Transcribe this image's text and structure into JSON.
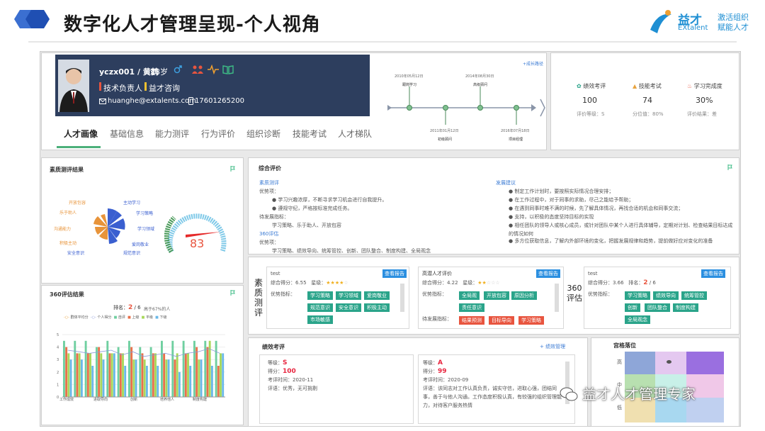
{
  "header": {
    "title": "数字化人才管理呈现-个人视角",
    "logo_brand": "益才",
    "logo_sub": "EXtalent",
    "logo_slogan_1": "激活组织",
    "logo_slogan_2": "赋能人才"
  },
  "profile": {
    "name": "yczx001 / 黄鹤",
    "age": "28岁",
    "role": "技术负责人",
    "company": "益才咨询",
    "email": "huanghe@extalents.com",
    "phone": "17601265200",
    "gender_icon": "male-icon"
  },
  "tabs": [
    "人才画像",
    "基础信息",
    "能力测评",
    "行为评价",
    "组织诊断",
    "技能考试",
    "人才梯队"
  ],
  "timeline": {
    "link": "+成长路径",
    "events": [
      {
        "date": "2010年05月12日",
        "title": "跟岗学习",
        "pos": "top"
      },
      {
        "date": "2011年01月12日",
        "title": "初级顾问",
        "pos": "bottom"
      },
      {
        "date": "2014年08月30日",
        "title": "高级顾问",
        "pos": "top"
      },
      {
        "date": "2016年07月18日",
        "title": "项目经理",
        "pos": "bottom"
      }
    ]
  },
  "stats": [
    {
      "label": "绩效考评",
      "value": "100",
      "sub": "评价等级：S",
      "color": "#2aa48a"
    },
    {
      "label": "技能考试",
      "value": "74",
      "sub": "分位值：80%",
      "color": "#e8a33f"
    },
    {
      "label": "学习完成度",
      "value": "30%",
      "sub": "评价结果：差",
      "color": "#e8553f"
    }
  ],
  "competency": {
    "title": "素质测评结果",
    "labels": [
      "主动学习",
      "学习策略",
      "学习领域",
      "爱岗敬业",
      "规范意识",
      "安全意识",
      "积极主动",
      "沟通能力",
      "乐于助人",
      "开放包容"
    ],
    "score": "83"
  },
  "eval360": {
    "title": "360评估结果",
    "rank_label": "排名：",
    "rank": "2",
    "rank_total": "/ 6",
    "rank_note": "高于67%的人",
    "legend": [
      "群体平均分",
      "个人得分",
      "自评",
      "上级",
      "平级",
      "下级"
    ],
    "categories": [
      "工作成效",
      "进取导向",
      "创新",
      "培养他人",
      "制度构建"
    ]
  },
  "chart_data": {
    "type": "bar",
    "title": "360评估结果",
    "categories": [
      "工作成效",
      "进取导向",
      "创新",
      "培养他人",
      "制度构建"
    ],
    "ylim": [
      0,
      5
    ],
    "series": [
      {
        "name": "自评",
        "values": [
          4.5,
          4.5,
          4.5,
          4.0,
          4.5,
          4.0,
          4.5,
          4.0,
          4.0,
          4.5,
          4.5,
          4.5,
          4.5,
          4.5,
          4.5
        ]
      },
      {
        "name": "上级",
        "values": [
          4.0,
          3.5,
          3.5,
          4.0,
          3.5,
          3.5,
          4.0,
          3.5,
          3.5,
          3.5,
          3.0,
          3.5,
          4.0,
          4.0,
          2.5
        ]
      },
      {
        "name": "平级",
        "values": [
          3.5,
          3.5,
          3.5,
          3.5,
          3.5,
          3.5,
          3.0,
          3.0,
          3.5,
          3.0,
          3.5,
          3.5,
          3.0,
          4.5,
          3.5
        ]
      },
      {
        "name": "下级",
        "values": [
          3.0,
          3.0,
          2.5,
          3.0,
          3.5,
          2.5,
          3.0,
          2.5,
          2.5,
          3.0,
          2.0,
          2.5,
          3.0,
          2.5,
          3.5
        ]
      }
    ]
  },
  "comprehensive": {
    "title": "综合评价",
    "quality_title": "素质测评",
    "adv_label": "优势项：",
    "adv": [
      "学习兴趣浓厚，不断寻求学习机会进行自我提升。",
      "遵规守纪，严格按标准完成任务。"
    ],
    "dev_label": "待发展指标：",
    "dev_text": "学习策略、乐于助人、开放包容",
    "eval_title": "360评估",
    "eval_adv_label": "优势项：",
    "eval_adv": "学习策略、绩效导向、统筹管控、创新、团队整合、制度构建、全局观念",
    "suggest_title": "发展建议",
    "suggest": [
      "制定工作计划时，要按照实际情况合理安排；",
      "在工作过程中，对于同事的求助，尽己之能给予帮助；",
      "在遇到同事时难不满的时候，先了解具体情况，再找合适的机会和同事交流；",
      "支持，以积极的态度坚持目标的实现",
      "相任团队的领导人或核心成员，或针对团队中某个人进行具体辅导，定期对计划、检查结果目标达成的情况如何",
      "多方位获取信息，了解内外部环境的变化，把握发展规律和趋势，提前做好应对变化的准备"
    ]
  },
  "quality_card": {
    "side": "素质测评",
    "name": "test",
    "score_label": "综合得分：",
    "score": "6.55",
    "star_label": "星级：",
    "stars": 4,
    "report": "查看报告",
    "adv_label": "优势指标：",
    "tags": [
      "学习策略",
      "学习领域",
      "爱岗敬业",
      "规范意识",
      "安全意识",
      "积极主动",
      "市场敏感"
    ]
  },
  "potential_card": {
    "name": "高潜人才评价",
    "score_label": "综合得分：",
    "score": "4.22",
    "star_label": "星级：",
    "stars": 2,
    "report": "查看报告",
    "adv_label": "优势指标：",
    "tags": [
      "全局观",
      "开放包容",
      "原因分析",
      "责任意识"
    ],
    "dev_label": "待发展指标：",
    "dev_tags": [
      "结果预测",
      "目标导向",
      "学习策略"
    ]
  },
  "eval_card": {
    "side": "360评估",
    "name": "test",
    "score_label": "综合得分：",
    "score": "3.66",
    "rank_label": "排名：",
    "rank": "2",
    "rank_total": "/ 6",
    "report": "查看报告",
    "adv_label": "优势指标：",
    "tags": [
      "学习策略",
      "绩效导向",
      "统筹管控",
      "创新",
      "团队整合",
      "制度构建",
      "全局观念"
    ]
  },
  "performance": {
    "title": "绩效考评",
    "link": "+ 绩效管理",
    "records": [
      {
        "grade_label": "等级：",
        "grade": "S",
        "score_label": "得分：",
        "score": "100",
        "time_label": "考评时间：",
        "time": "2020-11",
        "comment_label": "评语：",
        "comment": "优秀，无可挑剔"
      },
      {
        "grade_label": "等级：",
        "grade": "A",
        "score_label": "得分：",
        "score": "99",
        "time_label": "考评时间：",
        "time": "2020-09",
        "comment_label": "评语：",
        "comment": "该同志对工作认真负责，诚实守信，进取心强，团结同事，善于与他人沟通。工作态度积极认真，有较强的组织管理能力，对待客户服务热情"
      }
    ]
  },
  "grid": {
    "title": "宫格落位",
    "rows": [
      "高",
      "中",
      "低"
    ]
  },
  "watermark": "益才人才管理专家"
}
